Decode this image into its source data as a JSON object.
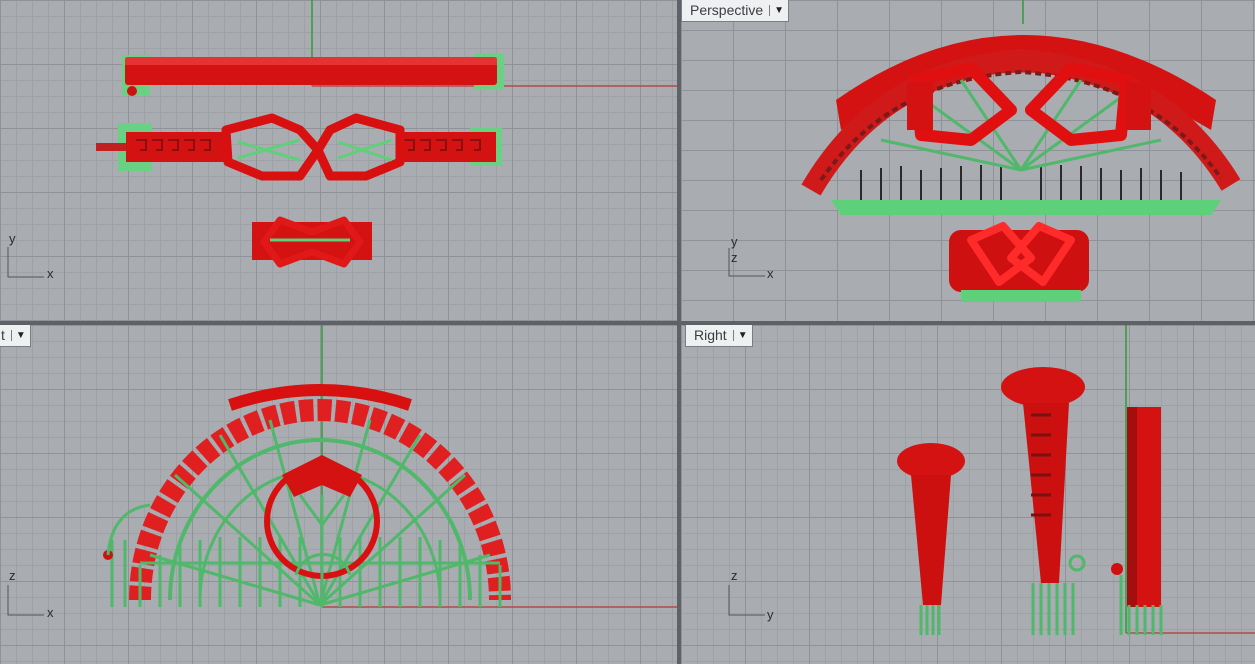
{
  "viewports": {
    "top": {
      "title": "",
      "axis_v": "y",
      "axis_h": "x"
    },
    "perspective": {
      "title": "Perspective",
      "axis_v": "y",
      "axis_z": "z",
      "axis_h": "x"
    },
    "front": {
      "title": "t",
      "axis_v": "z",
      "axis_h": "x"
    },
    "right": {
      "title": "Right",
      "axis_v": "z",
      "axis_h": "y"
    }
  },
  "icons": {
    "dropdown": "dropdown-arrow-icon"
  },
  "colors": {
    "viewport_bg": "#a9acb0",
    "grid_major": "#8f9296",
    "model_red": "#e01010",
    "support_green": "#5fd07a",
    "axis_x": "#b34a4a",
    "axis_y": "#2f9c3a",
    "divider": "#5e6166"
  }
}
